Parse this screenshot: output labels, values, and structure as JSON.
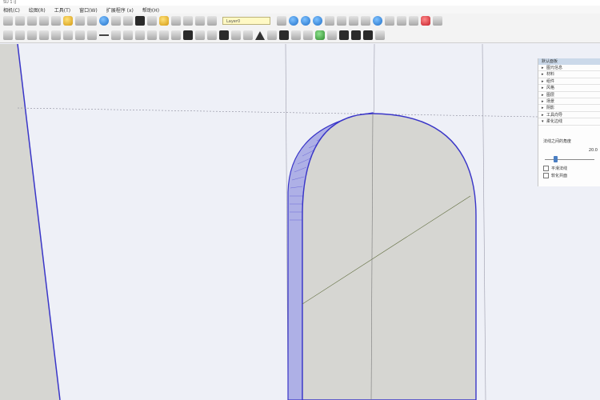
{
  "window": {
    "title": "SU 1 iJ"
  },
  "menubar": {
    "items": [
      "相机(C)",
      "绘图(R)",
      "工具(T)",
      "窗口(W)",
      "扩展程序 (x)",
      "帮助(H)"
    ]
  },
  "toolbar": {
    "scene_field": "Layer0"
  },
  "panel": {
    "header": "默认面板",
    "sections": [
      "图元信息",
      "材料",
      "组件",
      "风格",
      "图层",
      "场景",
      "阴影",
      "工具向导",
      "柔化边线"
    ],
    "normal_angle_label": "法线之间的角度",
    "normal_angle_value": "20.0",
    "checkbox_smooth": "平滑法线",
    "checkbox_coplanar": "软化共面"
  },
  "colors": {
    "ui_background": "#f3f3f3",
    "viewport_background": "#eef0f7",
    "model_face": "#d6d6d2",
    "model_edge": "#3a36c8",
    "panel_header": "#cbd9ea"
  }
}
